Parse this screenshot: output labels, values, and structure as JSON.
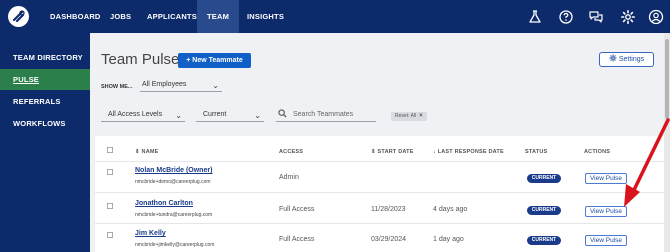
{
  "nav": {
    "items": [
      {
        "label": "DASHBOARD"
      },
      {
        "label": "JOBS"
      },
      {
        "label": "APPLICANTS"
      },
      {
        "label": "TEAM"
      },
      {
        "label": "INSIGHTS"
      }
    ],
    "icons": [
      "flask-icon",
      "help-circle-icon",
      "chat-icon",
      "gear-icon",
      "account-circle-icon"
    ]
  },
  "sidebar": {
    "items": [
      {
        "label": "TEAM DIRECTORY"
      },
      {
        "label": "PULSE"
      },
      {
        "label": "REFERRALS"
      },
      {
        "label": "WORKFLOWS"
      }
    ]
  },
  "page": {
    "title": "Team Pulse",
    "new_button": "+  New Teammate",
    "settings_button": "Settings"
  },
  "filters": {
    "show_me_label": "SHOW ME...",
    "employees": "All Employees",
    "access_levels": "All Access Levels",
    "status": "Current",
    "search_placeholder": "Search Teammates",
    "reset_chip": "Reset: All"
  },
  "table": {
    "headers": {
      "name": "NAME",
      "access": "ACCESS",
      "start_date": "START DATE",
      "last_response": "LAST RESPONSE DATE",
      "status": "STATUS",
      "actions": "ACTIONS"
    },
    "rows": [
      {
        "name": "Nolan McBride (Owner)",
        "email": "nmcbride+demo@careerplug.com",
        "access": "Admin",
        "start_date": "",
        "last_response": "",
        "status": "CURRENT",
        "action": "View Pulse"
      },
      {
        "name": "Jonathon Carlton",
        "email": "nmcbride+tundra@careerplug.com",
        "access": "Full Access",
        "start_date": "11/28/2023",
        "last_response": "4 days ago",
        "status": "CURRENT",
        "action": "View Pulse"
      },
      {
        "name": "Jim Kelly",
        "email": "nmcbride+jimkelly@careerplug.com",
        "access": "Full Access",
        "start_date": "03/29/2024",
        "last_response": "1 day ago",
        "status": "CURRENT",
        "action": "View Pulse"
      }
    ]
  },
  "colors": {
    "nav_bg": "#0d2b6b",
    "active_sidebar": "#2a7f4b",
    "primary": "#1060c8",
    "annotation_arrow": "#d9121b"
  }
}
